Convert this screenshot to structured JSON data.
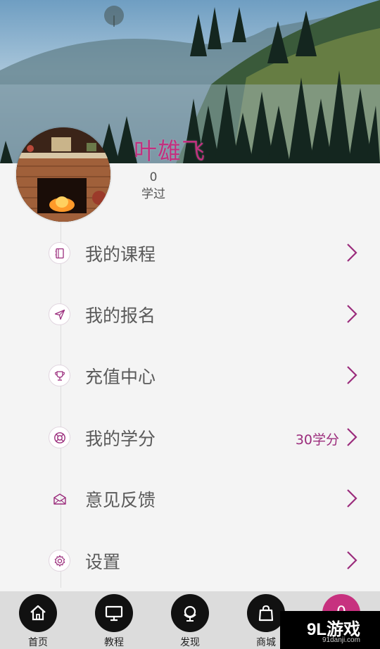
{
  "profile": {
    "username": "叶雄飞",
    "learned_count": "0",
    "learned_label": "学过"
  },
  "menu": [
    {
      "label": "我的课程",
      "value": "",
      "icon": "notebook-icon"
    },
    {
      "label": "我的报名",
      "value": "",
      "icon": "paper-plane-icon"
    },
    {
      "label": "充值中心",
      "value": "",
      "icon": "trophy-icon"
    },
    {
      "label": "我的学分",
      "value": "30学分",
      "icon": "lifebuoy-icon"
    },
    {
      "label": "意见反馈",
      "value": "",
      "icon": "envelope-icon"
    },
    {
      "label": "设置",
      "value": "",
      "icon": "gear-icon"
    }
  ],
  "bottom_nav": [
    {
      "label": "首页",
      "icon": "home-icon"
    },
    {
      "label": "教程",
      "icon": "monitor-icon"
    },
    {
      "label": "发现",
      "icon": "globe-icon"
    },
    {
      "label": "商城",
      "icon": "shopping-bag-icon"
    }
  ],
  "pink_button": {
    "text": "0"
  },
  "watermark": {
    "logo": "9L游戏",
    "site": "91danji.com"
  },
  "colors": {
    "accent": "#c2307f",
    "value": "#9b2c7c"
  }
}
